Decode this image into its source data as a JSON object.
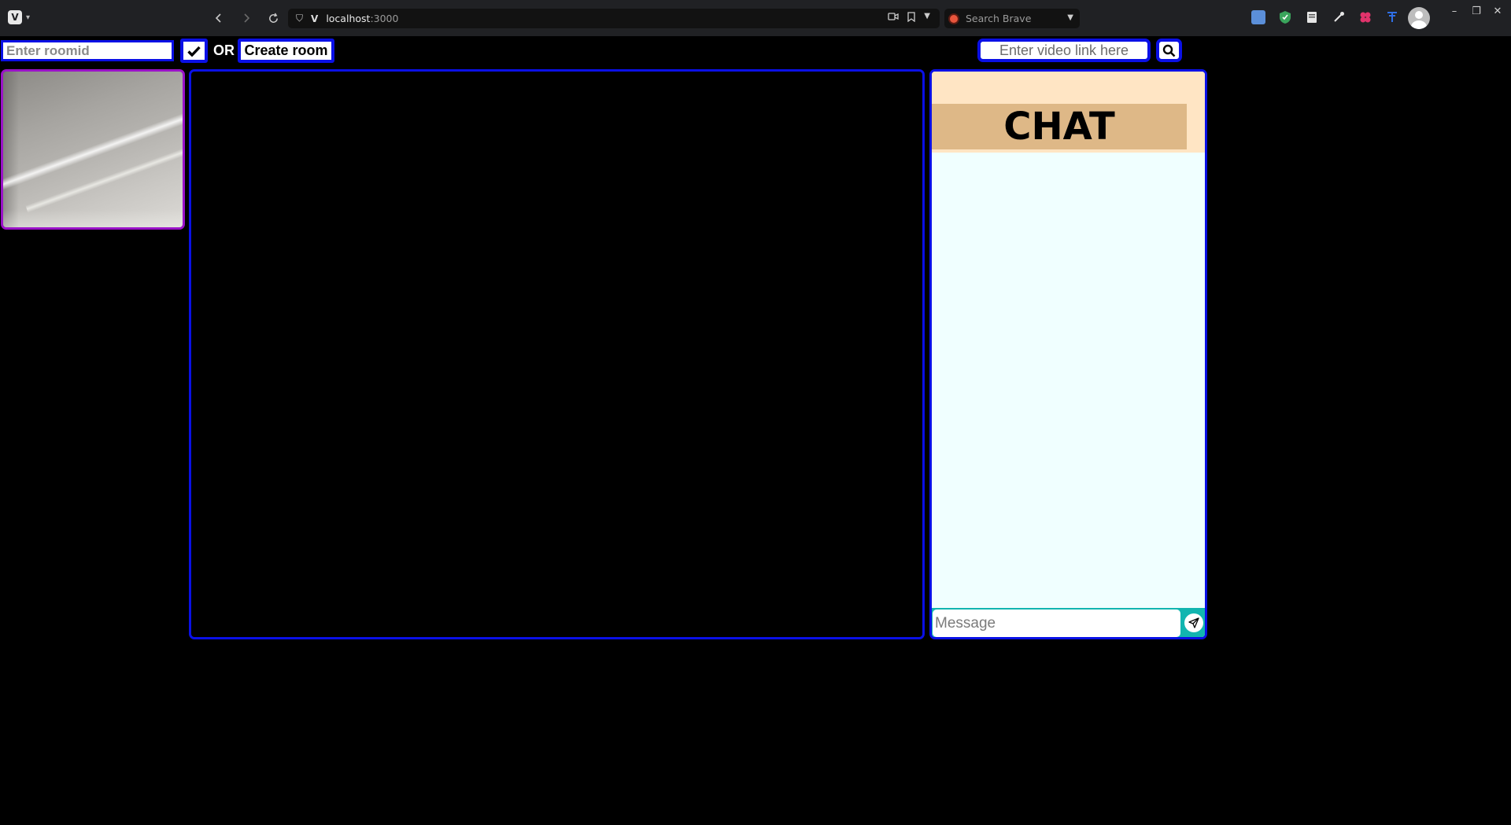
{
  "browser": {
    "app_logo": "V",
    "address": {
      "host": "localhost",
      "port": ":3000"
    },
    "search": {
      "placeholder": "Search Brave"
    },
    "icons": {
      "back": "arrow-left-icon",
      "forward": "arrow-right-icon",
      "reload": "reload-icon",
      "site_info": "shield-icon",
      "camera": "camera-icon",
      "bookmark": "bookmark-icon",
      "dropdown": "chevron-down-icon",
      "profile": "user-avatar-icon",
      "minimize": "minimize-icon",
      "restore": "restore-icon",
      "close": "close-icon"
    },
    "extensions": [
      {
        "name": "image-extension-icon",
        "color": "#5b8fd9"
      },
      {
        "name": "shield-extension-icon",
        "color": "#3aa55c"
      },
      {
        "name": "document-extension-icon",
        "color": "#e6e6e6"
      },
      {
        "name": "eyedropper-extension-icon",
        "color": "#e6e6e6"
      },
      {
        "name": "puzzle-extension-icon",
        "color": "#e0336b"
      },
      {
        "name": "translate-extension-icon",
        "color": "#2f6fe6"
      }
    ]
  },
  "room": {
    "roomid_placeholder": "Enter roomid",
    "join_icon": "checkmark-icon",
    "or_label": "OR",
    "create_label": "Create room"
  },
  "video_link": {
    "placeholder": "Enter video link here",
    "search_icon": "search-icon"
  },
  "chat": {
    "title": "CHAT",
    "message_placeholder": "Message",
    "send_icon": "paper-plane-icon"
  },
  "colors": {
    "accent_border": "#0a10e6",
    "camera_border": "#9a12c8",
    "chat_header_bg": "#ffe5c4",
    "chat_title_bg": "#deb887",
    "chat_body_bg": "#f0ffff",
    "chat_compose_bg": "#12b5b0"
  }
}
